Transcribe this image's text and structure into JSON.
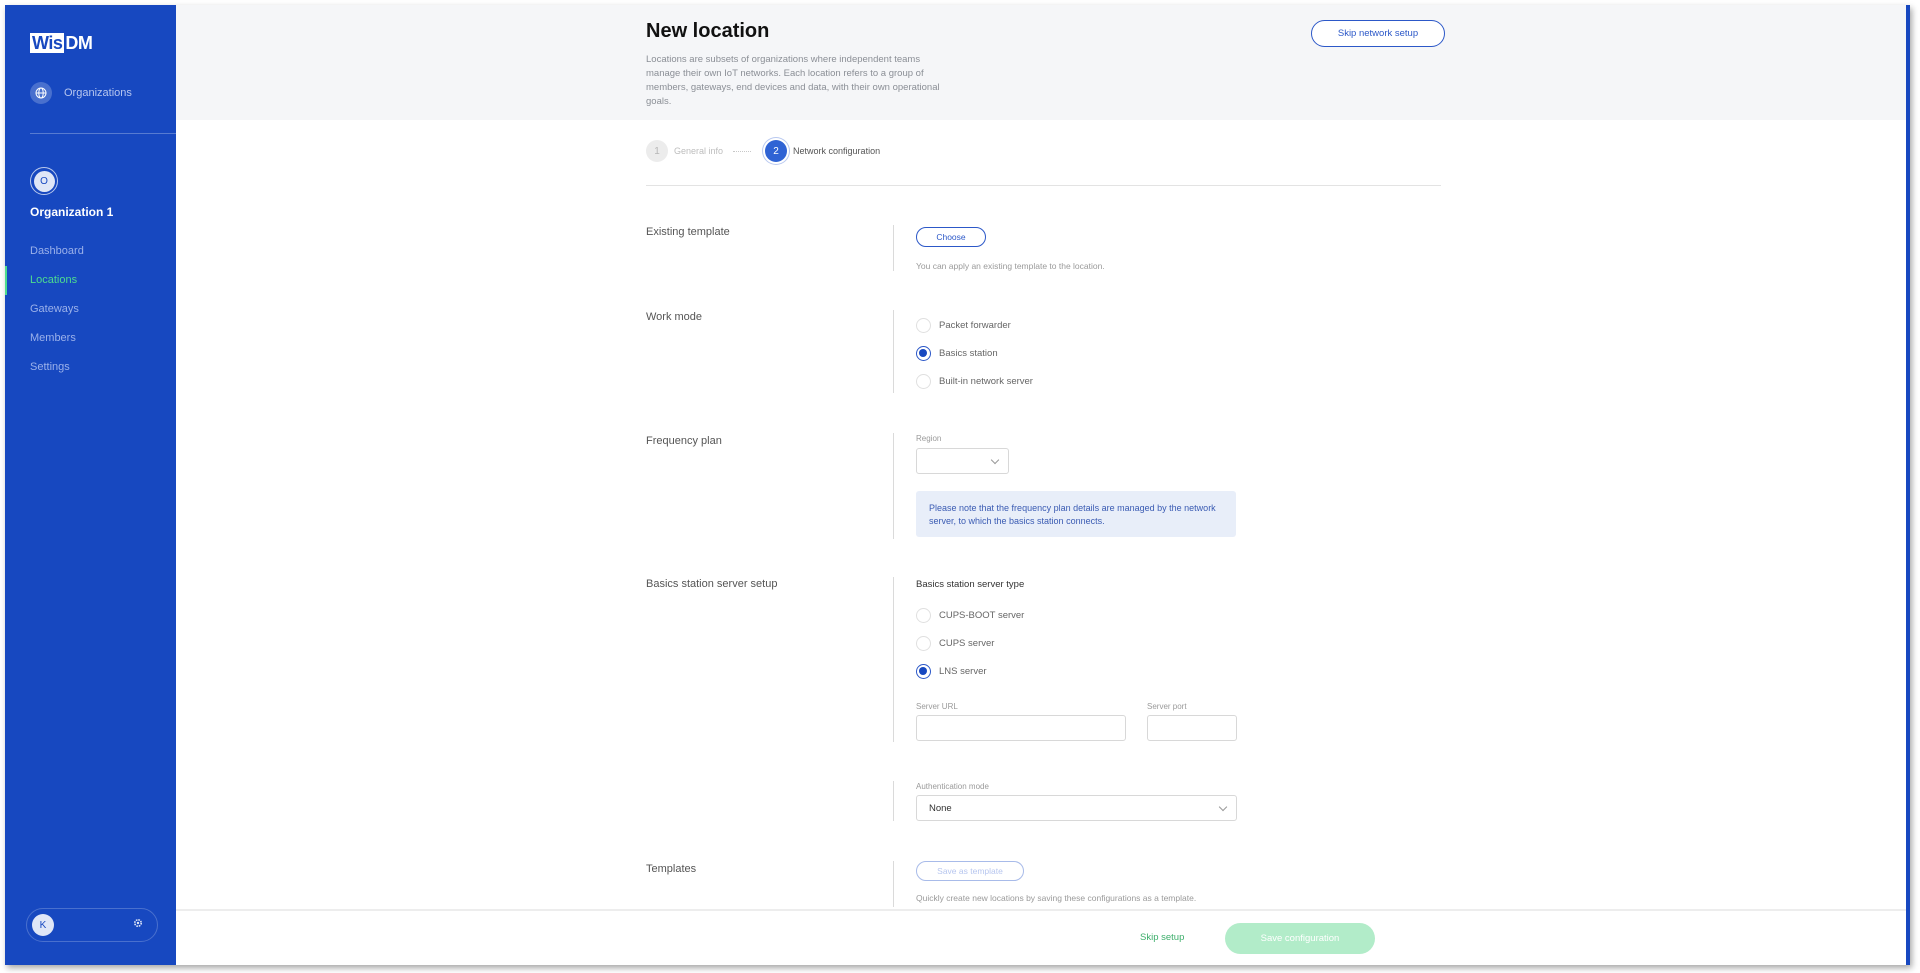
{
  "sidebar": {
    "logo_part1": "Wis",
    "logo_part2": "DM",
    "organizations_label": "Organizations",
    "organizations_icon": "globe-icon",
    "org_avatar_initial": "O",
    "org_name": "Organization 1",
    "items": [
      {
        "label": "Dashboard",
        "active": false
      },
      {
        "label": "Locations",
        "active": true
      },
      {
        "label": "Gateways",
        "active": false
      },
      {
        "label": "Members",
        "active": false
      },
      {
        "label": "Settings",
        "active": false
      }
    ],
    "user_initial": "K",
    "settings_icon": "gear-icon"
  },
  "header": {
    "title": "New location",
    "description": "Locations are subsets of organizations where independent teams manage their own IoT networks. Each location refers to a group of members, gateways, end devices and data, with their own operational goals.",
    "skip_network_setup": "Skip network setup"
  },
  "stepper": {
    "steps": [
      {
        "number": "1",
        "label": "General info",
        "state": "done"
      },
      {
        "number": "2",
        "label": "Network configuration",
        "state": "current"
      }
    ]
  },
  "sections": {
    "existing_template": {
      "title": "Existing template",
      "button": "Choose",
      "hint": "You can apply an existing template to the location."
    },
    "work_mode": {
      "title": "Work mode",
      "options": [
        {
          "label": "Packet forwarder",
          "checked": false
        },
        {
          "label": "Basics station",
          "checked": true
        },
        {
          "label": "Built-in network server",
          "checked": false
        }
      ]
    },
    "frequency_plan": {
      "title": "Frequency plan",
      "region_label": "Region",
      "region_value": "",
      "note": "Please note that the frequency plan details are managed by the network server, to which the basics station connects."
    },
    "basics_station": {
      "title": "Basics station server setup",
      "server_type_label": "Basics station server type",
      "options": [
        {
          "label": "CUPS-BOOT server",
          "checked": false
        },
        {
          "label": "CUPS server",
          "checked": true
        },
        {
          "label": "LNS server",
          "checked": true
        }
      ],
      "server_url_label": "Server URL",
      "server_url_value": "",
      "server_port_label": "Server port",
      "server_port_value": "",
      "auth_mode_label": "Authentication mode",
      "auth_mode_value": "None"
    },
    "templates": {
      "title": "Templates",
      "button": "Save as template",
      "hint": "Quickly create new locations by saving these configurations as a template."
    }
  },
  "footer": {
    "skip_setup": "Skip setup",
    "save_configuration": "Save configuration"
  },
  "colors": {
    "brand_blue": "#1748c0",
    "accent_green": "#4ddc8f",
    "save_button_disabled": "#b2ecc9"
  }
}
